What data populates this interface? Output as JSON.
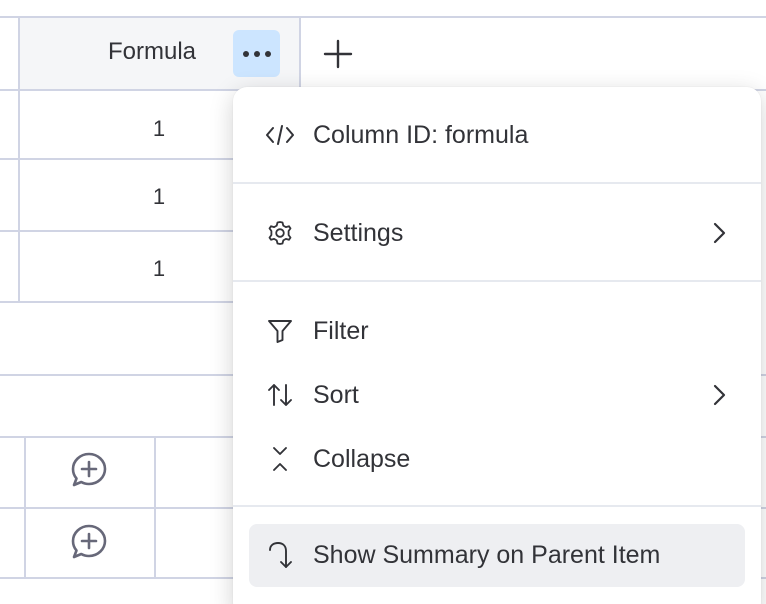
{
  "column": {
    "title": "Formula",
    "add_column_icon": "plus-icon",
    "menu_icon": "more-dots-icon",
    "values": [
      "1",
      "1",
      "1"
    ]
  },
  "menu": {
    "column_id": {
      "label": "Column ID: formula",
      "icon": "code-icon"
    },
    "settings": {
      "label": "Settings",
      "icon": "gear-icon",
      "has_submenu": true
    },
    "filter": {
      "label": "Filter",
      "icon": "filter-icon"
    },
    "sort": {
      "label": "Sort",
      "icon": "sort-icon",
      "has_submenu": true
    },
    "collapse": {
      "label": "Collapse",
      "icon": "collapse-icon"
    },
    "summary": {
      "label": "Show Summary on Parent Item",
      "icon": "curved-arrow-icon"
    }
  },
  "colors": {
    "accent_bg": "#cce5ff",
    "grid_line": "#d0d4e4",
    "hover_bg": "#eeeff2",
    "text": "#323338"
  }
}
